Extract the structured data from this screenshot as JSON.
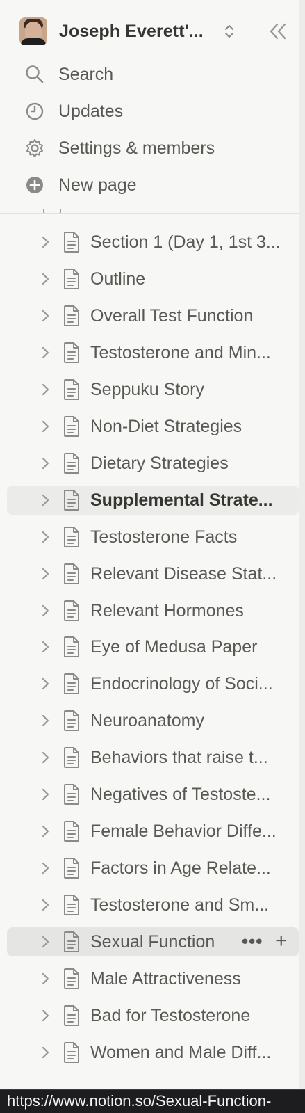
{
  "workspace": {
    "name": "Joseph Everett'...",
    "avatar_icon": "user-avatar"
  },
  "nav": [
    {
      "label": "Search",
      "icon": "search-icon"
    },
    {
      "label": "Updates",
      "icon": "clock-icon"
    },
    {
      "label": "Settings & members",
      "icon": "gear-icon"
    },
    {
      "label": "New page",
      "icon": "plus-circle-icon"
    }
  ],
  "pages": [
    {
      "title": "Section 1 (Day 1, 1st 3..."
    },
    {
      "title": "Outline"
    },
    {
      "title": "Overall Test Function"
    },
    {
      "title": "Testosterone and Min..."
    },
    {
      "title": "Seppuku Story"
    },
    {
      "title": "Non-Diet Strategies"
    },
    {
      "title": "Dietary Strategies"
    },
    {
      "title": "Supplemental Strate..."
    },
    {
      "title": "Testosterone Facts"
    },
    {
      "title": "Relevant Disease Stat..."
    },
    {
      "title": "Relevant Hormones"
    },
    {
      "title": "Eye of Medusa Paper"
    },
    {
      "title": "Endocrinology of Soci..."
    },
    {
      "title": "Neuroanatomy"
    },
    {
      "title": "Behaviors that raise t..."
    },
    {
      "title": "Negatives of Testoste..."
    },
    {
      "title": "Female Behavior Diffe..."
    },
    {
      "title": "Factors in Age Relate..."
    },
    {
      "title": "Testosterone and Sm..."
    },
    {
      "title": "Sexual Function"
    },
    {
      "title": "Male Attractiveness"
    },
    {
      "title": "Bad for Testosterone"
    },
    {
      "title": "Women and Male Diff..."
    }
  ],
  "row_actions": {
    "more": "•••",
    "add": "+"
  },
  "status_url": "https://www.notion.so/Sexual-Function-",
  "colors": {
    "sidebar_bg": "#f7f7f5",
    "text": "#37352f",
    "muted_text": "#5a5853",
    "selected_bg": "#ebebea"
  }
}
